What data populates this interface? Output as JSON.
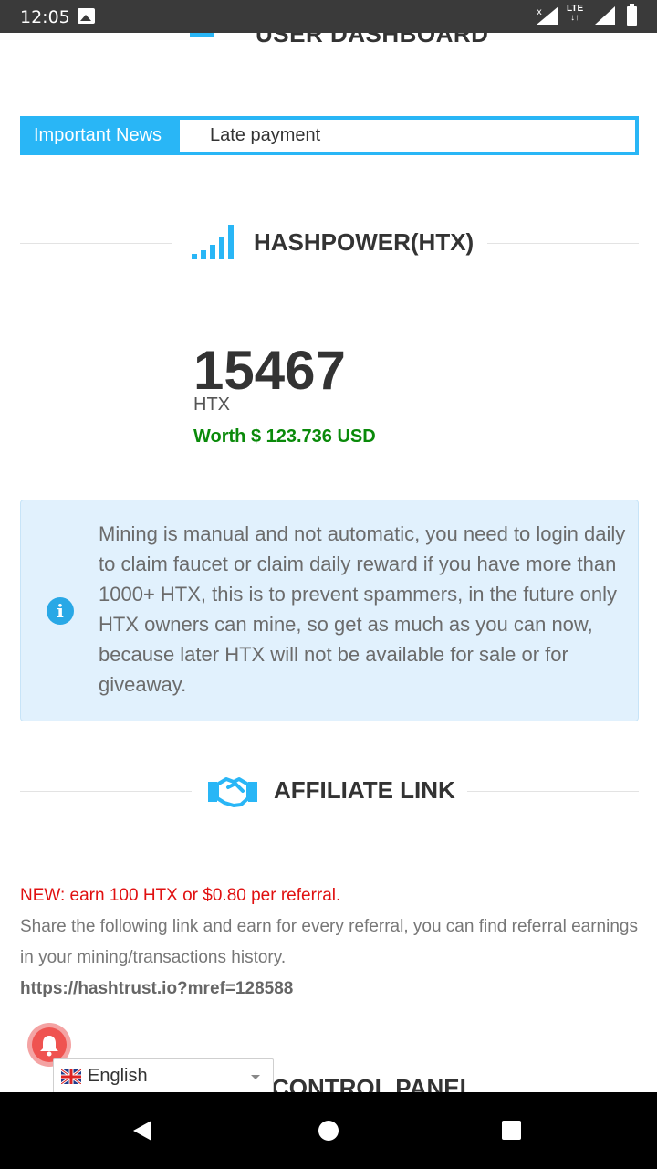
{
  "status_bar": {
    "time": "12:05",
    "network": "LTE"
  },
  "dashboard": {
    "title": "USER DASHBOARD"
  },
  "news": {
    "label": "Important News",
    "text": "Late payment"
  },
  "hashpower": {
    "title": "HASHPOWER(HTX)",
    "amount": "15467",
    "unit": "HTX",
    "worth": "Worth $ 123.736 USD"
  },
  "alert": {
    "icon": "info-icon",
    "message": "Mining is manual and not automatic, you need to login daily to claim faucet or claim daily reward if you have more than 1000+ HTX, this is to prevent spammers, in the future only HTX owners can mine, so get as much as you can now, because later HTX will not be available for sale or for giveaway."
  },
  "affiliate": {
    "title": "AFFILIATE LINK",
    "new_text": "NEW: earn 100 HTX or $0.80 per referral.",
    "description": "Share the following link and earn for every referral, you can find referral earnings in your mining/transactions history.",
    "link": "https://hashtrust.io?mref=128588"
  },
  "language": {
    "selected": "English"
  },
  "control_panel": {
    "title": "CONTROL PANEL"
  },
  "colors": {
    "accent": "#29b6f6",
    "worth": "#0a8a0a",
    "new": "#e01010",
    "alert_bg": "#e1f1fd"
  }
}
